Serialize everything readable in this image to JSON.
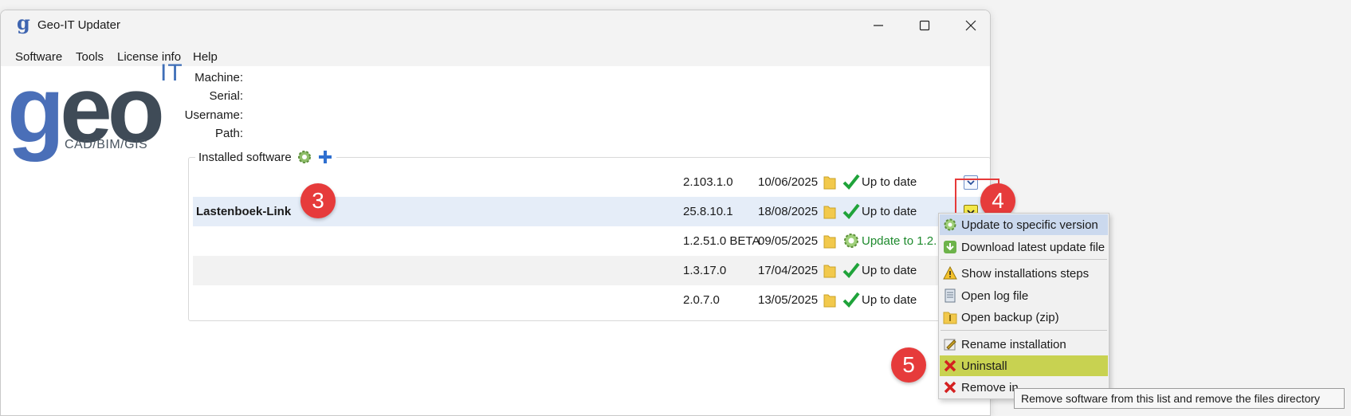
{
  "window": {
    "title": "Geo-IT Updater",
    "icon": "geo-app-icon"
  },
  "menu": {
    "items": [
      "Software",
      "Tools",
      "License info",
      "Help"
    ]
  },
  "logo": {
    "main_g": "g",
    "main_eo": "eo",
    "superscript": "IT",
    "subtitle": "CAD/BIM/GIS"
  },
  "info": {
    "machine_label": "Machine:",
    "serial_label": "Serial:",
    "username_label": "Username:",
    "path_label": "Path:"
  },
  "installed": {
    "title": "Installed software",
    "rows": [
      {
        "name": "",
        "version": "2.103.1.0",
        "date": "10/06/2025",
        "status": "Up to date",
        "status_icon": "check-icon"
      },
      {
        "name": "Lastenboek-Link",
        "version": "25.8.10.1",
        "date": "18/08/2025",
        "status": "Up to date",
        "status_icon": "check-icon"
      },
      {
        "name": "",
        "version": "1.2.51.0 BETA",
        "date": "09/05/2025",
        "status": "Update to 1.2.",
        "status_icon": "update-gear-icon"
      },
      {
        "name": "",
        "version": "1.3.17.0",
        "date": "17/04/2025",
        "status": "Up to date",
        "status_icon": "check-icon"
      },
      {
        "name": "",
        "version": "2.0.7.0",
        "date": "13/05/2025",
        "status": "Up to date",
        "status_icon": "check-icon"
      }
    ]
  },
  "badges": {
    "b3": "3",
    "b4": "4",
    "b5": "5"
  },
  "context_menu": {
    "items": [
      {
        "label": "Update to specific version",
        "icon": "update-gear-icon"
      },
      {
        "label": "Download latest update file",
        "icon": "download-icon"
      },
      {
        "label": "Show installations steps",
        "icon": "warning-icon"
      },
      {
        "label": "Open log file",
        "icon": "log-file-icon"
      },
      {
        "label": "Open backup (zip)",
        "icon": "zip-folder-icon"
      },
      {
        "label": "Rename installation",
        "icon": "rename-icon"
      },
      {
        "label": "Uninstall",
        "icon": "red-x-icon"
      },
      {
        "label": "Remove in",
        "icon": "red-x-icon"
      }
    ]
  },
  "tooltip": {
    "text": "Remove software from this list and remove the files directory"
  },
  "colors": {
    "accent": "#4a6fb8",
    "badge": "#e63b3b",
    "uninstall_highlight": "#c8d251",
    "hover": "#cbd9ee"
  }
}
